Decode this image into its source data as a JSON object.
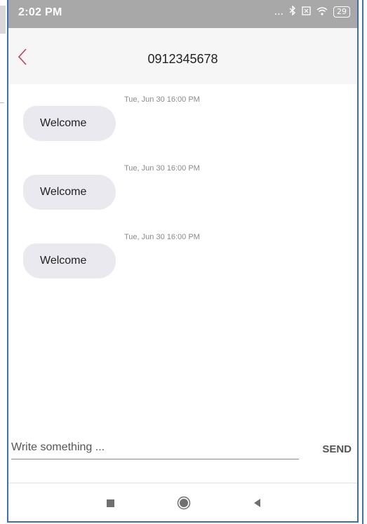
{
  "status_bar": {
    "time": "2:02 PM",
    "dots": "...",
    "bluetooth_icon": "bluetooth-icon",
    "sim_icon": "sim-icon",
    "wifi_icon": "wifi-icon",
    "battery": "29"
  },
  "header": {
    "back_icon": "chevron-left-icon",
    "title": "0912345678",
    "accent_color": "#c0405a"
  },
  "messages": [
    {
      "time": "Tue, Jun 30 16:00 PM",
      "text": "Welcome"
    },
    {
      "time": "Tue, Jun 30 16:00 PM",
      "text": "Welcome"
    },
    {
      "time": "Tue, Jun 30 16:00 PM",
      "text": "Welcome"
    }
  ],
  "composer": {
    "placeholder": "Write something ...",
    "value": "",
    "send_label": "SEND"
  },
  "navbar": {
    "recent_icon": "square-icon",
    "home_icon": "circle-icon",
    "back_icon": "triangle-left-icon"
  }
}
